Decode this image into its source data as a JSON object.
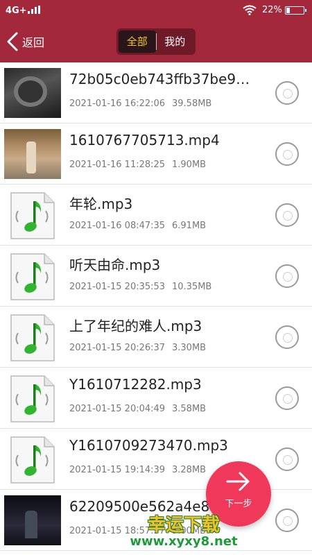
{
  "status_bar": {
    "network": "4G+",
    "battery_text": "22%",
    "battery_level": 0.22
  },
  "header": {
    "back_label": "返回",
    "tabs": [
      {
        "label": "全部",
        "active": true
      },
      {
        "label": "我的",
        "active": false
      }
    ]
  },
  "files": [
    {
      "name": "72b05c0eb743ffb37be9…",
      "date": "2021-01-16 16:22:06",
      "size": "39.58MB",
      "kind": "video",
      "icon": "video-thumbnail"
    },
    {
      "name": "1610767705713.mp4",
      "date": "2021-01-16 11:28:25",
      "size": "1.90MB",
      "kind": "video",
      "icon": "video-thumbnail"
    },
    {
      "name": "年轮.mp3",
      "date": "2021-01-16 08:47:35",
      "size": "6.91MB",
      "kind": "audio",
      "icon": "music-note-icon"
    },
    {
      "name": "听天由命.mp3",
      "date": "2021-01-15 20:35:53",
      "size": "10.35MB",
      "kind": "audio",
      "icon": "music-note-icon"
    },
    {
      "name": "上了年纪的难人.mp3",
      "date": "2021-01-15 20:26:37",
      "size": "3.30MB",
      "kind": "audio",
      "icon": "music-note-icon"
    },
    {
      "name": "Y1610712282.mp3",
      "date": "2021-01-15 20:04:49",
      "size": "3.58MB",
      "kind": "audio",
      "icon": "music-note-icon"
    },
    {
      "name": "Y1610709273470.mp3",
      "date": "2021-01-15 19:14:39",
      "size": "3.28MB",
      "kind": "audio",
      "icon": "music-note-icon"
    },
    {
      "name": "62209500e562a4e8…",
      "date": "2021-01-15 18:57:37",
      "size": "5.00MB",
      "kind": "video",
      "icon": "video-thumbnail"
    }
  ],
  "fab": {
    "label": "下一步",
    "icon": "arrow-right-icon"
  },
  "watermark": {
    "title": "幸运下载",
    "url": "www.xyxy8.net"
  },
  "colors": {
    "header_bg": "#a3283c",
    "segment_active_text": "#f5c518",
    "fab_bg": "#f0385a",
    "note_green": "#2fb52f"
  }
}
